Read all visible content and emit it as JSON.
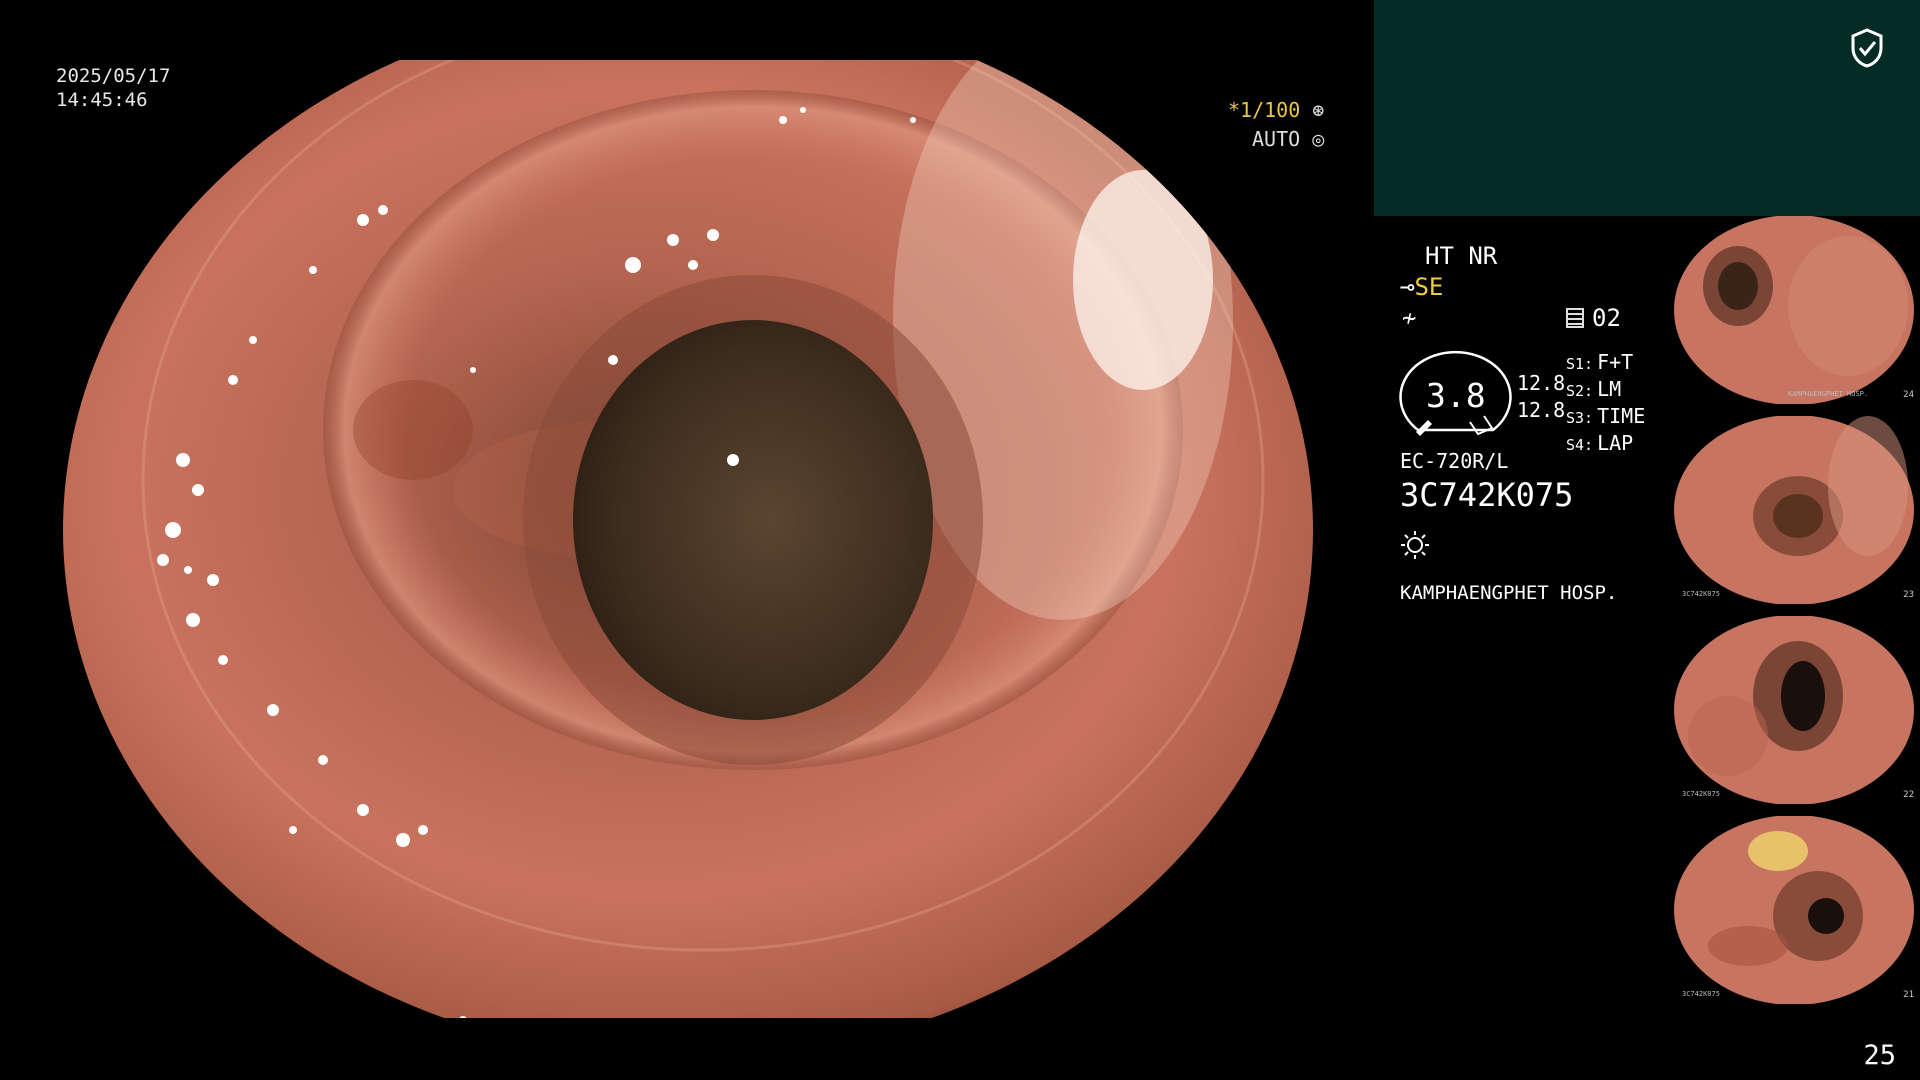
{
  "overlay": {
    "date": "2025/05/17",
    "time": "14:45:46",
    "shutter": "*1/100",
    "shutter_icon": "aperture-icon",
    "iris": "AUTO",
    "iris_icon": "iris-icon"
  },
  "panel": {
    "mode": "HT NR",
    "enhance": "SE",
    "enhance_symbol": "⊸",
    "f_symbol": "≁",
    "memory": "02",
    "gauge_value": "3.8",
    "values": [
      "12.8",
      "12.8"
    ],
    "switches": [
      {
        "key": "S1:",
        "value": "F+T"
      },
      {
        "key": "S2:",
        "value": "LM"
      },
      {
        "key": "S3:",
        "value": "TIME"
      },
      {
        "key": "S4:",
        "value": "LAP"
      }
    ],
    "scope_model": "EC-720R/L",
    "scope_serial": "3C742K075",
    "hospital": "KAMPHAENGPHET HOSP.",
    "shield_icon": "shield-check-icon",
    "light_icon": "light-source-icon"
  },
  "thumbnails": [
    {
      "caption": "KAMPHAENGPHET HOSP.",
      "number": "24"
    },
    {
      "caption": "3C742K075",
      "number": "23"
    },
    {
      "caption": "3C742K075",
      "number": "22"
    },
    {
      "caption": "3C742K075",
      "number": "21"
    }
  ],
  "page_number": "25",
  "colors": {
    "panel_bg": "#042b24",
    "accent_yellow": "#f1cc47",
    "tissue": "#c9735e"
  }
}
